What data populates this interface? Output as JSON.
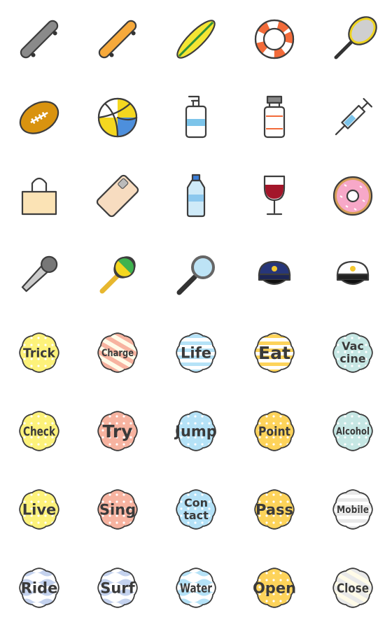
{
  "colors": {
    "outline": "#3d3d3d",
    "yellow": "#fdf27a",
    "salmon": "#f7b3a0",
    "sky": "#b5e2f7",
    "gold": "#fdd35a",
    "mint": "#c6e7e4",
    "gray": "#e9e9e9",
    "lavender": "#c4d2ee",
    "cream": "#fffbe8"
  },
  "icons": [
    {
      "icon": "skateboard-gray-icon"
    },
    {
      "icon": "skateboard-orange-icon"
    },
    {
      "icon": "surfboard-icon"
    },
    {
      "icon": "lifebuoy-icon"
    },
    {
      "icon": "tennis-racket-icon"
    },
    {
      "icon": "rugby-ball-icon"
    },
    {
      "icon": "volleyball-icon"
    },
    {
      "icon": "sanitizer-pump-bottle-icon"
    },
    {
      "icon": "vaccine-vial-icon"
    },
    {
      "icon": "syringe-icon"
    },
    {
      "icon": "shopping-bag-icon"
    },
    {
      "icon": "smartphone-icon"
    },
    {
      "icon": "water-bottle-icon"
    },
    {
      "icon": "wine-glass-icon"
    },
    {
      "icon": "donut-icon"
    },
    {
      "icon": "microphone-icon"
    },
    {
      "icon": "maraca-icon"
    },
    {
      "icon": "magnifying-glass-icon"
    },
    {
      "icon": "police-cap-icon"
    },
    {
      "icon": "captain-cap-icon"
    }
  ],
  "badges": [
    {
      "lines": [
        "Trick"
      ],
      "color": "yellow",
      "pattern": "dots"
    },
    {
      "lines": [
        "Charge"
      ],
      "color": "salmon",
      "pattern": "diagonal"
    },
    {
      "lines": [
        "Life"
      ],
      "color": "sky",
      "pattern": "hstripes"
    },
    {
      "lines": [
        "Eat"
      ],
      "color": "gold",
      "pattern": "hstripes"
    },
    {
      "lines": [
        "Vac",
        "cine"
      ],
      "color": "mint",
      "pattern": "dots"
    },
    {
      "lines": [
        "Check"
      ],
      "color": "yellow",
      "pattern": "dots"
    },
    {
      "lines": [
        "Try"
      ],
      "color": "salmon",
      "pattern": "dots"
    },
    {
      "lines": [
        "Jump"
      ],
      "color": "sky",
      "pattern": "dots"
    },
    {
      "lines": [
        "Point"
      ],
      "color": "gold",
      "pattern": "dots"
    },
    {
      "lines": [
        "Alcohol"
      ],
      "color": "mint",
      "pattern": "dots"
    },
    {
      "lines": [
        "Live"
      ],
      "color": "yellow",
      "pattern": "dots"
    },
    {
      "lines": [
        "Sing"
      ],
      "color": "salmon",
      "pattern": "dots"
    },
    {
      "lines": [
        "Con",
        "tact"
      ],
      "color": "sky",
      "pattern": "dots"
    },
    {
      "lines": [
        "Pass"
      ],
      "color": "gold",
      "pattern": "dots"
    },
    {
      "lines": [
        "Mobile"
      ],
      "color": "gray",
      "pattern": "hstripes"
    },
    {
      "lines": [
        "Ride"
      ],
      "color": "lavender",
      "pattern": "waves"
    },
    {
      "lines": [
        "Surf"
      ],
      "color": "lavender",
      "pattern": "waves"
    },
    {
      "lines": [
        "Water"
      ],
      "color": "sky",
      "pattern": "waves"
    },
    {
      "lines": [
        "Open"
      ],
      "color": "gold",
      "pattern": "dots"
    },
    {
      "lines": [
        "Close"
      ],
      "color": "gray",
      "pattern": "diagonal"
    }
  ]
}
